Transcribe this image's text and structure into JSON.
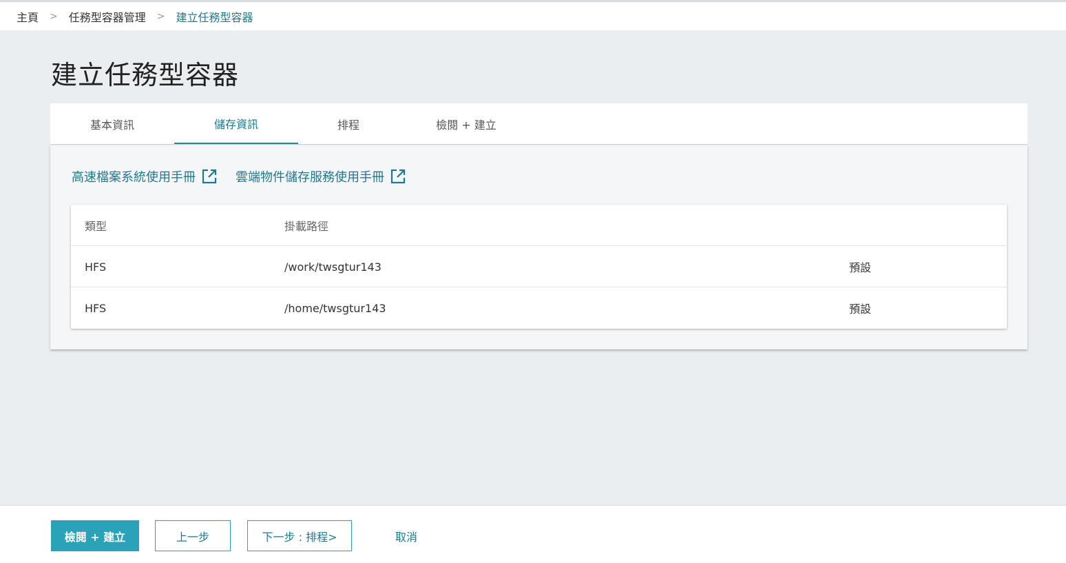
{
  "breadcrumb": {
    "items": [
      "主頁",
      "任務型容器管理",
      "建立任務型容器"
    ],
    "separator": ">"
  },
  "page": {
    "title": "建立任務型容器"
  },
  "tabs": [
    {
      "label": "基本資訊",
      "active": false
    },
    {
      "label": "儲存資訊",
      "active": true
    },
    {
      "label": "排程",
      "active": false
    },
    {
      "label": "檢閱 + 建立",
      "active": false
    }
  ],
  "links": [
    {
      "label": "高速檔案系統使用手冊",
      "icon": "external-link-icon"
    },
    {
      "label": "雲端物件儲存服務使用手冊",
      "icon": "external-link-icon"
    }
  ],
  "storage_table": {
    "headers": {
      "type": "類型",
      "path": "掛載路徑"
    },
    "rows": [
      {
        "type": "HFS",
        "path": "/work/twsgtur143",
        "flag": "預設"
      },
      {
        "type": "HFS",
        "path": "/home/twsgtur143",
        "flag": "預設"
      }
    ]
  },
  "footer": {
    "review_create": "檢閱 + 建立",
    "prev": "上一步",
    "next": "下一步 : 排程>",
    "cancel": "取消"
  },
  "colors": {
    "accent": "#2aa3b8",
    "link": "#1d7a8c",
    "background": "#ebeef1"
  }
}
